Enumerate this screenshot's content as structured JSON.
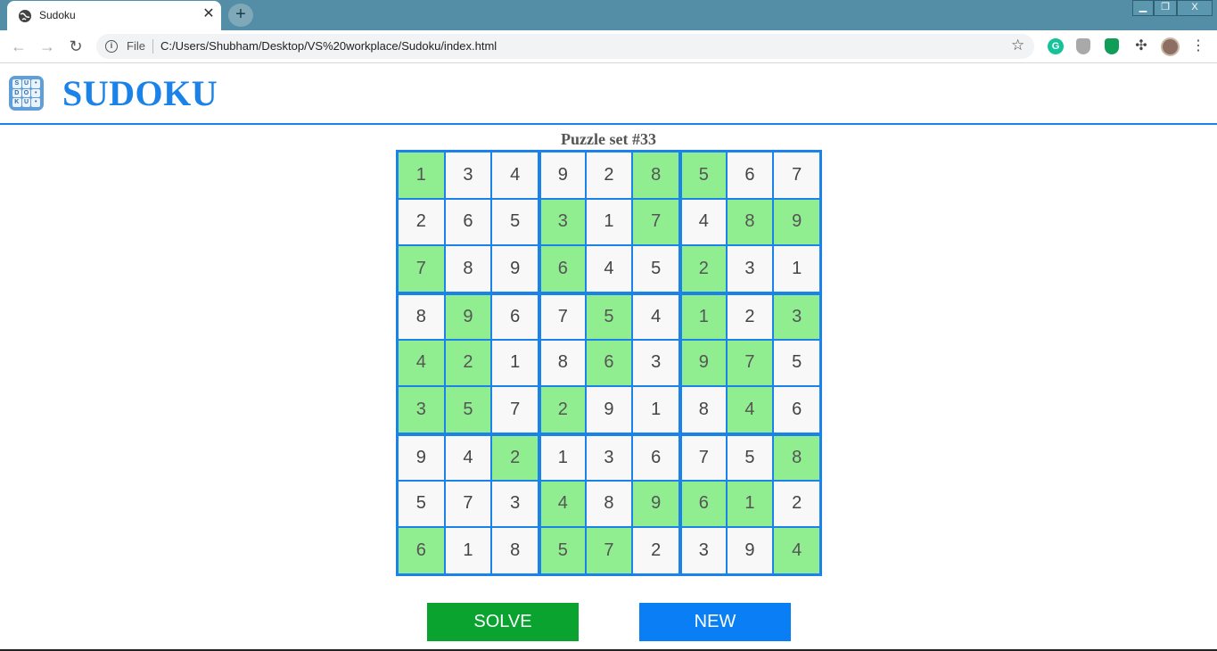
{
  "browser": {
    "tab_title": "Sudoku",
    "tab_close": "✕",
    "new_tab": "+",
    "window_controls": {
      "minimize": "▁",
      "maximize": "❐",
      "close": "X"
    },
    "nav": {
      "back": "←",
      "forward": "→",
      "reload": "↻"
    },
    "site_info_label": "File",
    "url": "C:/Users/Shubham/Desktop/VS%20workplace/Sudoku/index.html",
    "extensions": {
      "grammarly": "G"
    },
    "menu": "⋮",
    "icons": [
      "globe-icon",
      "info-icon",
      "star-icon",
      "grammarly-icon",
      "shield-icon",
      "adguard-icon",
      "puzzle-icon",
      "profile-avatar",
      "kebab-menu-icon"
    ]
  },
  "header": {
    "logo_letters": [
      "S",
      "U",
      "",
      "D",
      "O",
      "",
      "K",
      "U",
      ""
    ],
    "title": "SUDOKU"
  },
  "puzzle": {
    "label": "Puzzle set #33",
    "grid": [
      [
        1,
        3,
        4,
        9,
        2,
        8,
        5,
        6,
        7
      ],
      [
        2,
        6,
        5,
        3,
        1,
        7,
        4,
        8,
        9
      ],
      [
        7,
        8,
        9,
        6,
        4,
        5,
        2,
        3,
        1
      ],
      [
        8,
        9,
        6,
        7,
        5,
        4,
        1,
        2,
        3
      ],
      [
        4,
        2,
        1,
        8,
        6,
        3,
        9,
        7,
        5
      ],
      [
        3,
        5,
        7,
        2,
        9,
        1,
        8,
        4,
        6
      ],
      [
        9,
        4,
        2,
        1,
        3,
        6,
        7,
        5,
        8
      ],
      [
        5,
        7,
        3,
        4,
        8,
        9,
        6,
        1,
        2
      ],
      [
        6,
        1,
        8,
        5,
        7,
        2,
        3,
        9,
        4
      ]
    ],
    "given_mask": [
      [
        1,
        0,
        0,
        0,
        0,
        1,
        1,
        0,
        0
      ],
      [
        0,
        0,
        0,
        1,
        0,
        1,
        0,
        1,
        1
      ],
      [
        1,
        0,
        0,
        1,
        0,
        0,
        1,
        0,
        0
      ],
      [
        0,
        1,
        0,
        0,
        1,
        0,
        1,
        0,
        1
      ],
      [
        1,
        1,
        0,
        0,
        1,
        0,
        1,
        1,
        0
      ],
      [
        1,
        1,
        0,
        1,
        0,
        0,
        0,
        1,
        0
      ],
      [
        0,
        0,
        1,
        0,
        0,
        0,
        0,
        0,
        1
      ],
      [
        0,
        0,
        0,
        1,
        0,
        1,
        1,
        1,
        0
      ],
      [
        1,
        0,
        0,
        1,
        1,
        0,
        0,
        0,
        1
      ]
    ]
  },
  "actions": {
    "solve_label": "SOLVE",
    "new_label": "NEW"
  },
  "colors": {
    "accent": "#1a82e8",
    "given_cell": "#90ee90",
    "solve_button": "#0aa330",
    "new_button": "#0a7ff5"
  }
}
